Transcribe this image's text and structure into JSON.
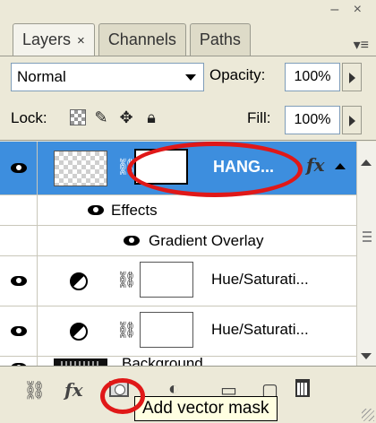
{
  "window": {
    "controls": "– ×"
  },
  "tabs": [
    {
      "label": "Layers",
      "close": "×",
      "active": true
    },
    {
      "label": "Channels",
      "active": false
    },
    {
      "label": "Paths",
      "active": false
    }
  ],
  "panel_menu_icon": "panel-menu-icon",
  "blend_mode": {
    "value": "Normal"
  },
  "opacity": {
    "label": "Opacity:",
    "value": "100%"
  },
  "lock": {
    "label": "Lock:",
    "icons": [
      "lock-transparent-icon",
      "lock-image-icon",
      "lock-position-icon",
      "lock-all-icon"
    ]
  },
  "fill": {
    "label": "Fill:",
    "value": "100%"
  },
  "layers": [
    {
      "name": "HANG...",
      "type": "text-with-mask",
      "selected": true,
      "has_fx": true,
      "fx_label": "fx"
    },
    {
      "name": "Effects",
      "type": "effects-header"
    },
    {
      "name": "Gradient Overlay",
      "type": "effect"
    },
    {
      "name": "Hue/Saturati...",
      "type": "adjustment"
    },
    {
      "name": "Hue/Saturati...",
      "type": "adjustment"
    },
    {
      "name": "Background",
      "type": "background"
    }
  ],
  "bottom_bar": {
    "fx_label": "fx",
    "icons": [
      "link-layers-icon",
      "layer-style-icon",
      "add-vector-mask-icon",
      "adjustment-layer-icon",
      "new-group-icon",
      "new-layer-icon",
      "trash-icon"
    ]
  },
  "tooltip": {
    "text": "Add vector mask"
  },
  "colors": {
    "selection": "#3d8ede",
    "callout": "#e01818",
    "panel": "#ece9d8"
  }
}
